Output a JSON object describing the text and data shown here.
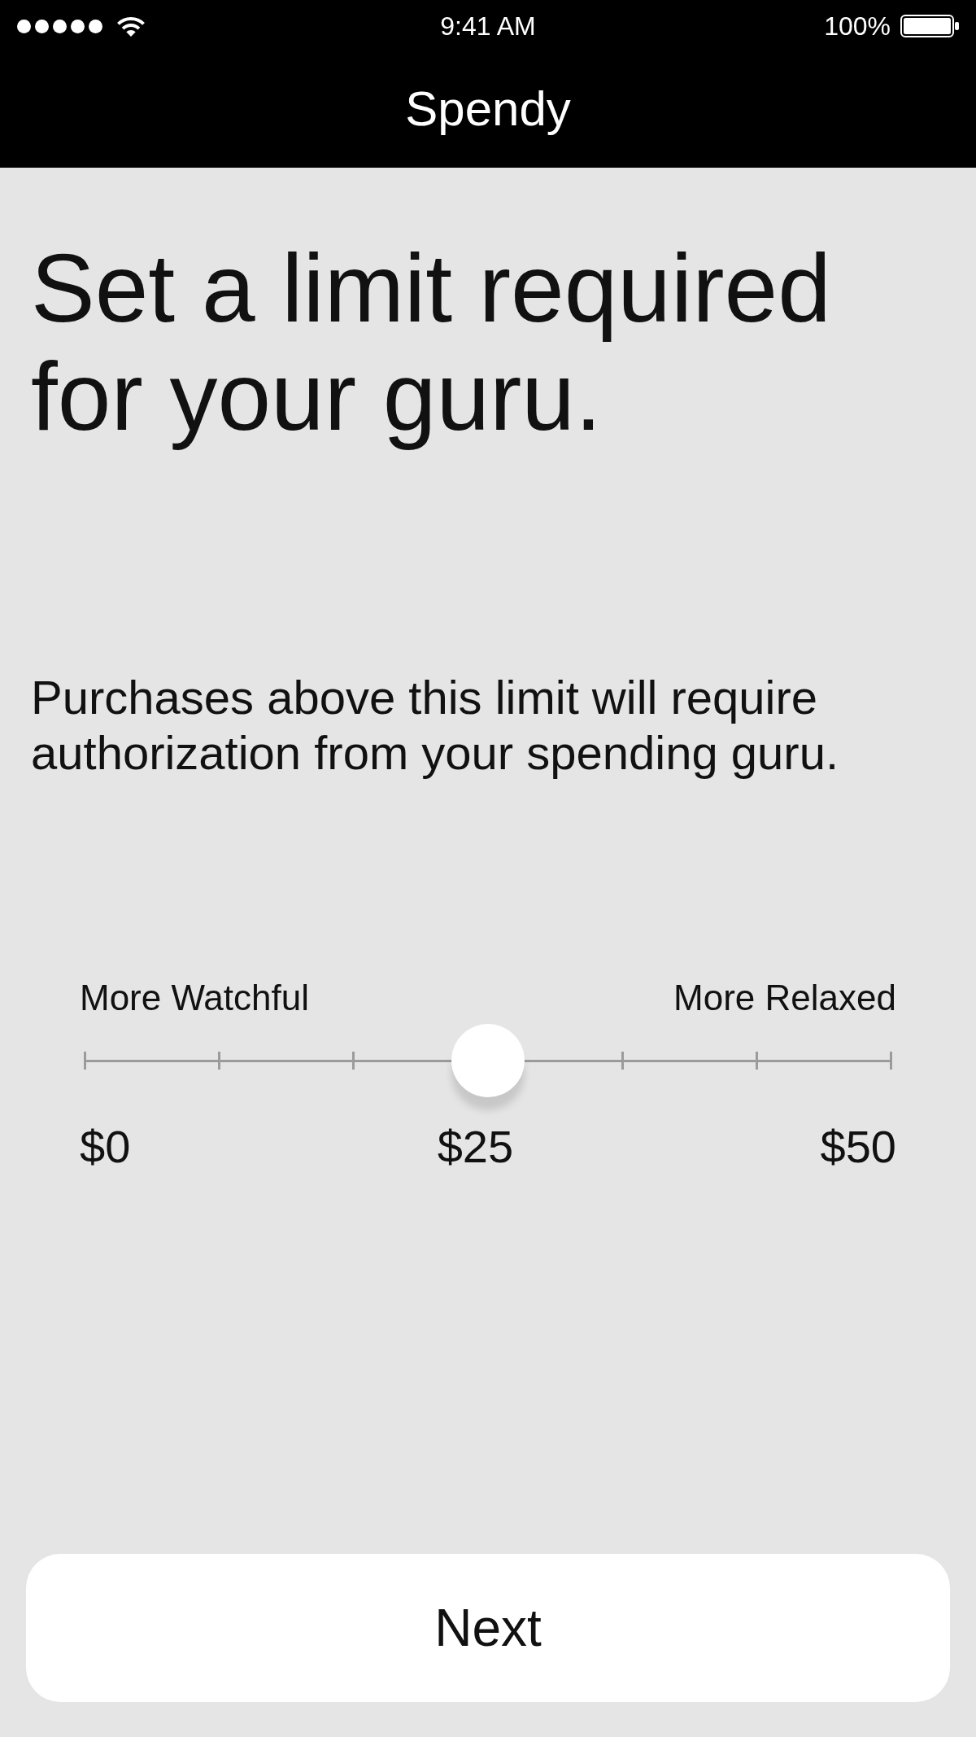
{
  "status_bar": {
    "time": "9:41 AM",
    "battery": "100%"
  },
  "nav_bar": {
    "title": "Spendy"
  },
  "heading": "Set a limit required for your guru.",
  "description": "Purchases above this limit will require authorization from your spending guru.",
  "slider": {
    "min_label": "More Watchful",
    "max_label": "More Relaxed",
    "level": 0.5,
    "values": [
      "$0",
      "$25",
      "$50"
    ]
  },
  "primary_button": {
    "label": "Next"
  }
}
